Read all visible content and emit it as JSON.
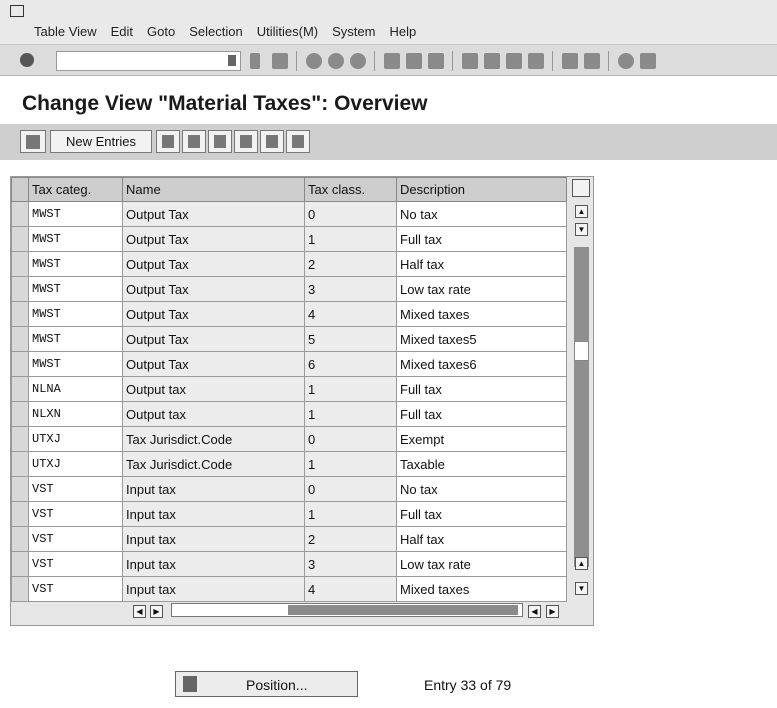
{
  "menu": [
    "Table View",
    "Edit",
    "Goto",
    "Selection",
    "Utilities(M)",
    "System",
    "Help"
  ],
  "toolbar": {
    "command_value": ""
  },
  "title": "Change View \"Material Taxes\": Overview",
  "app_toolbar": {
    "new_entries": "New Entries"
  },
  "table": {
    "columns": [
      "Tax categ.",
      "Name",
      "Tax class.",
      "Description"
    ],
    "rows": [
      [
        "MWST",
        "Output Tax",
        "0",
        "No tax"
      ],
      [
        "MWST",
        "Output Tax",
        "1",
        "Full tax"
      ],
      [
        "MWST",
        "Output Tax",
        "2",
        "Half tax"
      ],
      [
        "MWST",
        "Output Tax",
        "3",
        "Low tax rate"
      ],
      [
        "MWST",
        "Output Tax",
        "4",
        "Mixed taxes"
      ],
      [
        "MWST",
        "Output Tax",
        "5",
        "Mixed taxes5"
      ],
      [
        "MWST",
        "Output Tax",
        "6",
        "Mixed taxes6"
      ],
      [
        "NLNA",
        "Output tax",
        "1",
        "Full tax"
      ],
      [
        "NLXN",
        "Output tax",
        "1",
        "Full tax"
      ],
      [
        "UTXJ",
        "Tax Jurisdict.Code",
        "0",
        "Exempt"
      ],
      [
        "UTXJ",
        "Tax Jurisdict.Code",
        "1",
        "Taxable"
      ],
      [
        "VST",
        "Input tax",
        "0",
        "No tax"
      ],
      [
        "VST",
        "Input tax",
        "1",
        "Full tax"
      ],
      [
        "VST",
        "Input tax",
        "2",
        "Half tax"
      ],
      [
        "VST",
        "Input tax",
        "3",
        "Low tax rate"
      ],
      [
        "VST",
        "Input tax",
        "4",
        "Mixed taxes"
      ]
    ]
  },
  "footer": {
    "position_label": "Position...",
    "entry_text": "Entry 33 of 79"
  }
}
